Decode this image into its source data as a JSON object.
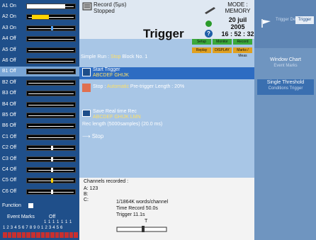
{
  "channels": [
    {
      "label": "A1  On",
      "fill_color": "#ffffff",
      "fill_start": 0.0,
      "fill_end": 0.8,
      "marker": null
    },
    {
      "label": "A2  On",
      "fill_color": "#ffd400",
      "fill_start": 0.1,
      "fill_end": 0.45,
      "marker": null
    },
    {
      "label": "A3  On",
      "fill_color": null,
      "fill_start": 0,
      "fill_end": 0,
      "marker": {
        "pos": 0.5,
        "color": "#4fa3ff"
      }
    },
    {
      "label": "A4  Off",
      "fill_color": null,
      "fill_start": 0,
      "fill_end": 0,
      "marker": null
    },
    {
      "label": "A5  Off",
      "fill_color": null,
      "fill_start": 0,
      "fill_end": 0,
      "marker": null
    },
    {
      "label": "A6  Off",
      "fill_color": null,
      "fill_start": 0,
      "fill_end": 0,
      "marker": null
    },
    {
      "label": "B1  Off",
      "fill_color": null,
      "fill_start": 0,
      "fill_end": 0,
      "marker": null,
      "selected": true
    },
    {
      "label": "B2  Off",
      "fill_color": null,
      "fill_start": 0,
      "fill_end": 0,
      "marker": null
    },
    {
      "label": "B3  Off",
      "fill_color": null,
      "fill_start": 0,
      "fill_end": 0,
      "marker": null
    },
    {
      "label": "B4  Off",
      "fill_color": null,
      "fill_start": 0,
      "fill_end": 0,
      "marker": null
    },
    {
      "label": "B5  Off",
      "fill_color": null,
      "fill_start": 0,
      "fill_end": 0,
      "marker": null
    },
    {
      "label": "B6  Off",
      "fill_color": null,
      "fill_start": 0,
      "fill_end": 0,
      "marker": null
    },
    {
      "label": "C1  Off",
      "fill_color": null,
      "fill_start": 0,
      "fill_end": 0,
      "marker": null
    },
    {
      "label": "C2  Off",
      "fill_color": null,
      "fill_start": 0,
      "fill_end": 0,
      "marker": {
        "pos": 0.5,
        "color": "#ffffff"
      }
    },
    {
      "label": "C3  Off",
      "fill_color": null,
      "fill_start": 0,
      "fill_end": 0,
      "marker": {
        "pos": 0.5,
        "color": "#ffffff"
      }
    },
    {
      "label": "C4  Off",
      "fill_color": null,
      "fill_start": 0,
      "fill_end": 0,
      "marker": {
        "pos": 0.5,
        "color": "#ffffff"
      }
    },
    {
      "label": "C5  Off",
      "fill_color": null,
      "fill_start": 0,
      "fill_end": 0,
      "marker": {
        "pos": 0.5,
        "color": "#ffd400"
      }
    },
    {
      "label": "C6  Off",
      "fill_color": null,
      "fill_start": 0,
      "fill_end": 0,
      "marker": {
        "pos": 0.5,
        "color": "#ffffff"
      }
    }
  ],
  "function_label": "Function",
  "event_marks": {
    "title": "Event Marks",
    "off": "Off",
    "ones": "1 1 1 1 1 1 1",
    "numbers": "1 2 3 4 5 6 7 8 9 0 1 2 3 4 5 6"
  },
  "recorder": {
    "title": "Record (5μs)",
    "status": "Stopped",
    "mode_label": "MODE :",
    "mode_value": "MEMORY",
    "date": "20 juil 2005",
    "time": "16 : 52 : 32"
  },
  "page_title": "Trigger",
  "mode_buttons": [
    {
      "label": "Setup",
      "color": "#3aa83a"
    },
    {
      "label": "Monitor",
      "color": "#3aa83a"
    },
    {
      "label": "Record",
      "color": "#3aa83a"
    },
    {
      "label": "Replay",
      "color": "#e0a020"
    },
    {
      "label": "DISPLAY",
      "color": "#e0a020"
    },
    {
      "label": "Marks / Meas",
      "color": "#e0a020"
    }
  ],
  "simple_run": {
    "prefix": "Simple Run : ",
    "value": "Stop",
    "suffix": "  Block No. 1"
  },
  "start": {
    "title": "Start Trigger",
    "value": "ABCDEF GHIJK"
  },
  "stop": {
    "prefix": "Stop : ",
    "value": "Automatic",
    "suffix": "  Pre-trigger Length : 20%"
  },
  "save": {
    "title": "Save Real time Rec",
    "value": "ABCDEF GHIJK LMN"
  },
  "length_line": "Rec length  (5000samples)  (20.0 ms)",
  "stop_action": "Stop",
  "channels_recorded": {
    "title": "Channels recorded :",
    "a": "A: 123",
    "b": "B:",
    "c": "C:",
    "words": "1/1864K words/channel",
    "time_record": "Time Record  50.0s",
    "trigger": "Trigger   11.1s",
    "slider_label": "T"
  },
  "right_panel": {
    "ghost_text": "Trigger Delay",
    "tab_label": "Trigger",
    "item1_title": "Window Chart",
    "item1_sub": "Event Marks",
    "item2_title": "Single Threshold",
    "item2_sub": "Conditions Trigger"
  },
  "colors": {
    "left_bg": "#1f4f8a",
    "mid_bg": "#a8c6e6",
    "right_bg": "#6f95c0",
    "accent_yellow": "#ffe066"
  }
}
